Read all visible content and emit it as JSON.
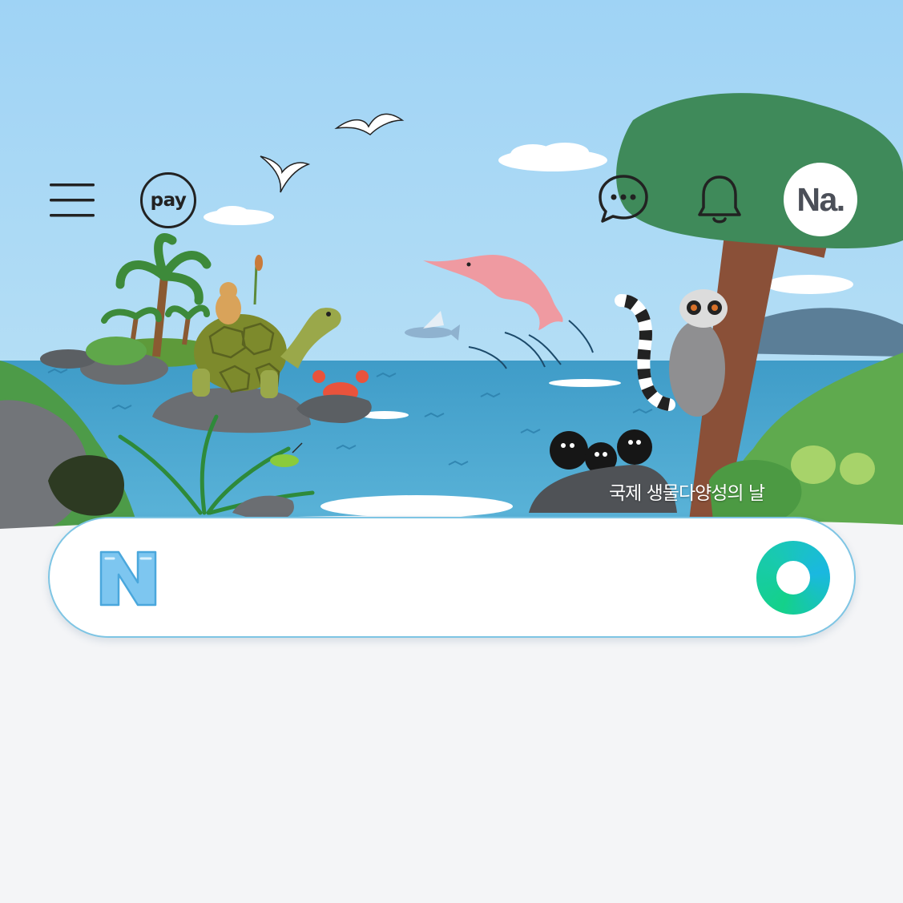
{
  "header": {
    "menu_icon": "hamburger-menu-icon",
    "pay_label": "pay",
    "talk_icon": "chat-bubble-icon",
    "notification_icon": "bell-icon",
    "profile_label": "Na."
  },
  "banner": {
    "caption": "국제 생물다양성의 날"
  },
  "search": {
    "logo_letter": "N",
    "placeholder": "",
    "value": "",
    "greendot_icon": "greendot-icon"
  },
  "colors": {
    "sky": "#a6d6f4",
    "sea": "#4aa6cf",
    "page_background": "#f4f5f7",
    "search_border": "#7ec5e4",
    "greendot": "#14d18a"
  }
}
